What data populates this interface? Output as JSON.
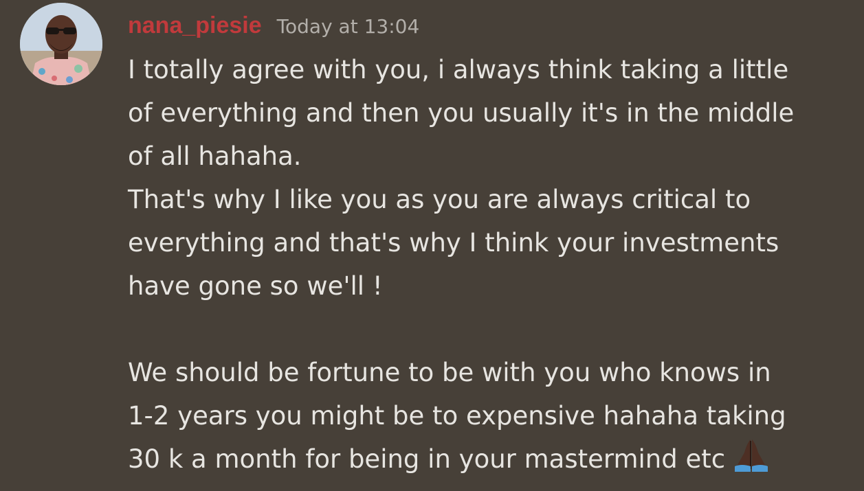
{
  "message": {
    "author": "nana_piesie",
    "timestamp": "Today at 13:04",
    "avatar_icon": "user-avatar-photo",
    "name_color": "#c13a3c",
    "paragraphs": [
      [
        "I totally agree with you, i always think taking a little",
        "of everything and then you usually it's in the middle",
        "of all hahaha."
      ],
      [
        "That's why I like you as you are always critical to",
        "everything and that's why I think your investments",
        "have gone so we'll !"
      ],
      [
        "We should be fortune to be with you who knows in",
        "1-2 years you might be to expensive hahaha taking",
        "30 k a month for being in your mastermind etc"
      ]
    ],
    "trailing_emoji": "folded-hands-emoji"
  }
}
